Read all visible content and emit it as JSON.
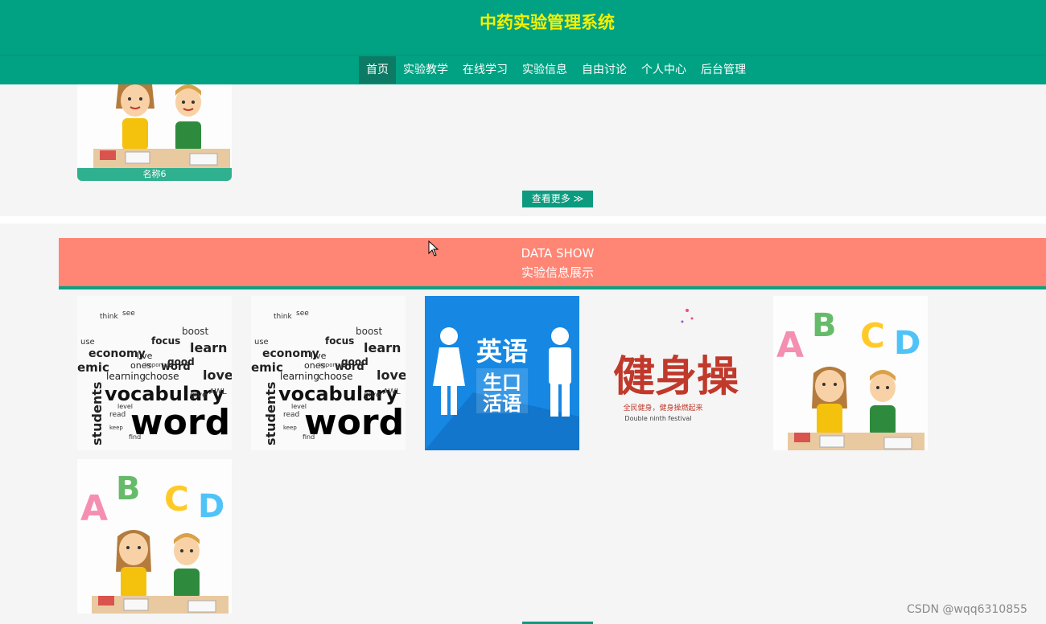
{
  "header": {
    "title": "中药实验管理系统"
  },
  "nav": {
    "items": [
      {
        "label": "首页",
        "active": true
      },
      {
        "label": "实验教学",
        "active": false
      },
      {
        "label": "在线学习",
        "active": false
      },
      {
        "label": "实验信息",
        "active": false
      },
      {
        "label": "自由讨论",
        "active": false
      },
      {
        "label": "个人中心",
        "active": false
      },
      {
        "label": "后台管理",
        "active": false
      }
    ]
  },
  "featured": {
    "card_label": "名称6",
    "more_label": "查看更多 ≫"
  },
  "banner": {
    "title_en": "DATA SHOW",
    "title_cn": "实验信息展示"
  },
  "thumbs": {
    "vocab1": [
      "use",
      "think",
      "see",
      "economy",
      "focus",
      "good",
      "learn",
      "live",
      "ones",
      "emic",
      "learning",
      "choose",
      "word",
      "love",
      "students",
      "vocabulary",
      "words",
      "boost",
      "AWL",
      "give",
      "important",
      "read",
      "find",
      "keep",
      "level"
    ],
    "vocab2": [
      "use",
      "think",
      "see",
      "economy",
      "focus",
      "good",
      "learn",
      "live",
      "ones",
      "emic",
      "learning",
      "choose",
      "word",
      "love",
      "students",
      "vocabulary",
      "words",
      "boost",
      "AWL",
      "give",
      "important",
      "read",
      "find",
      "keep",
      "level"
    ],
    "english": {
      "line1": "英语",
      "line2": "生口",
      "line3": "活语"
    },
    "fitness": {
      "title": "健身操",
      "caption": "全民健身，健身操燃起来",
      "caption_en": "Double ninth festival"
    },
    "abc": {
      "letters": [
        "A",
        "B",
        "C",
        "D"
      ]
    },
    "abc2": {
      "letters": [
        "A",
        "B",
        "C",
        "D"
      ]
    }
  },
  "watermark": "CSDN @wqq6310855",
  "colors": {
    "header": "#00a283",
    "title": "#f4f000",
    "banner": "#ff8574",
    "accent": "#0c9b7e"
  }
}
